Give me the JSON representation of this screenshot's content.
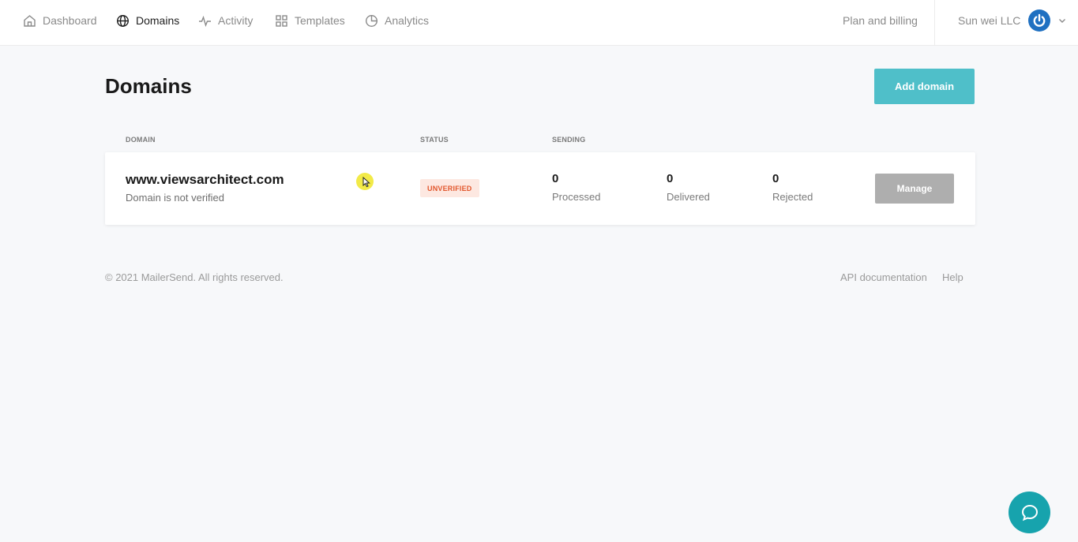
{
  "nav": {
    "items": [
      {
        "label": "Dashboard",
        "icon": "home-icon"
      },
      {
        "label": "Domains",
        "icon": "globe-icon"
      },
      {
        "label": "Activity",
        "icon": "activity-icon"
      },
      {
        "label": "Templates",
        "icon": "grid-icon"
      },
      {
        "label": "Analytics",
        "icon": "pie-chart-icon"
      }
    ],
    "active": "Domains",
    "plan_billing": "Plan and billing",
    "account_name": "Sun wei LLC"
  },
  "page": {
    "title": "Domains",
    "add_button": "Add domain"
  },
  "table": {
    "headers": {
      "domain": "DOMAIN",
      "status": "STATUS",
      "sending": "SENDING"
    },
    "rows": [
      {
        "domain": "www.viewsarchitect.com",
        "subtitle": "Domain is not verified",
        "status": "UNVERIFIED",
        "processed": {
          "value": "0",
          "label": "Processed"
        },
        "delivered": {
          "value": "0",
          "label": "Delivered"
        },
        "rejected": {
          "value": "0",
          "label": "Rejected"
        },
        "action": "Manage"
      }
    ]
  },
  "footer": {
    "copyright": "© 2021 MailerSend. All rights reserved.",
    "links": [
      "API documentation",
      "Help"
    ]
  },
  "colors": {
    "accent": "#4fbfc9",
    "chat": "#17a3ad",
    "status_unverified_bg": "#fde8e1",
    "status_unverified_text": "#e2572d",
    "brand_avatar": "#1f70c1"
  }
}
